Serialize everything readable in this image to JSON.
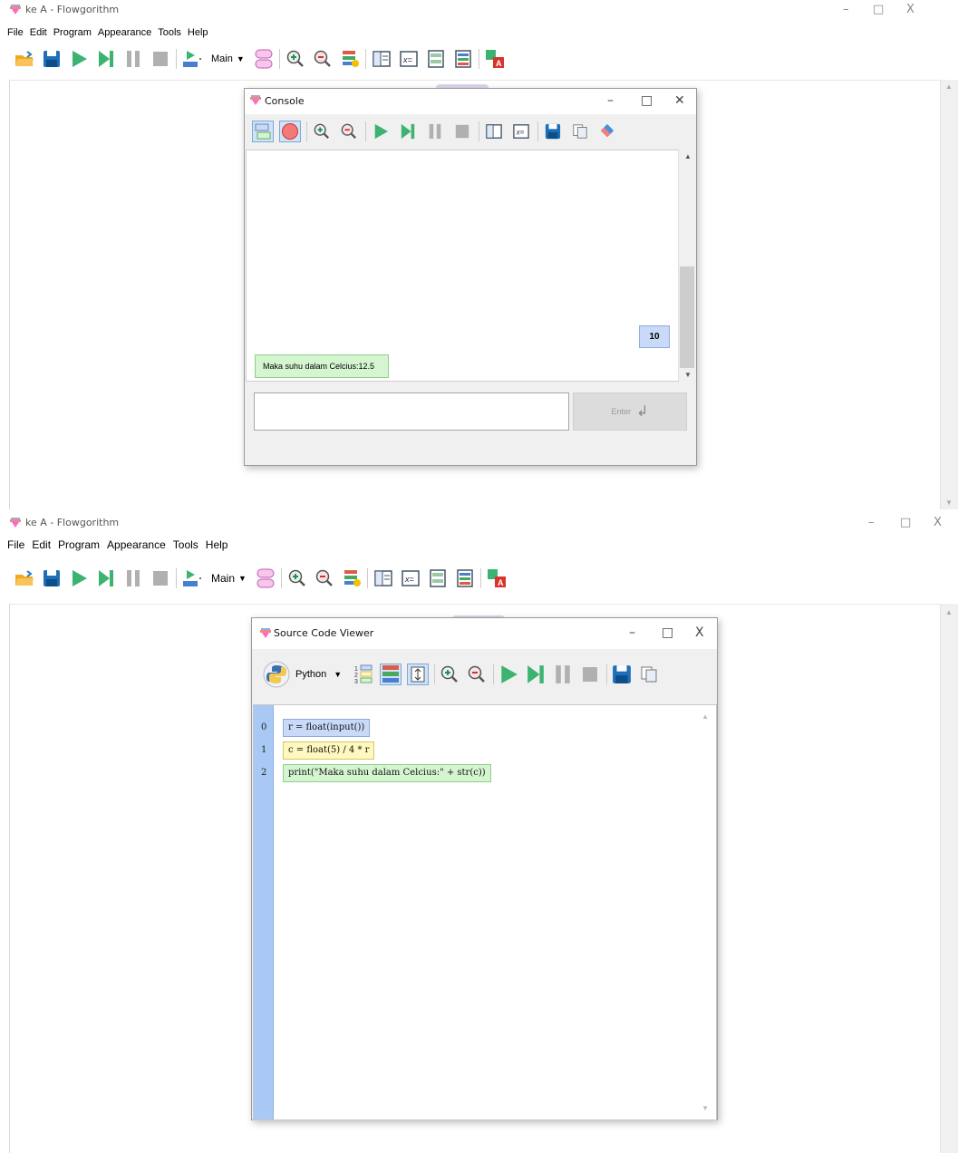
{
  "window1": {
    "title": "ke A - Flowgorithm",
    "controls": {
      "minimize": "–",
      "maximize": "□",
      "close": "X"
    },
    "menu": [
      "File",
      "Edit",
      "Program",
      "Appearance",
      "Tools",
      "Help"
    ],
    "function_selector": "Main",
    "console": {
      "title": "Console",
      "input_bubble": "10",
      "output_bubble": "Maka suhu dalam Celcius:12.5",
      "enter_label": "Enter"
    }
  },
  "window2": {
    "title": "ke A - Flowgorithm",
    "controls": {
      "minimize": "–",
      "maximize": "□",
      "close": "X"
    },
    "menu": [
      "File",
      "Edit",
      "Program",
      "Appearance",
      "Tools",
      "Help"
    ],
    "function_selector": "Main",
    "source_viewer": {
      "title": "Source Code Viewer",
      "language": "Python",
      "lines": [
        {
          "num": "0",
          "code": "r = float(input())"
        },
        {
          "num": "1",
          "code": "c = float(5) / 4 * r"
        },
        {
          "num": "2",
          "code": "print(\"Maka suhu dalam Celcius:\" + str(c))"
        }
      ]
    }
  },
  "colors": {
    "run": "#3cb371",
    "save": "#1e6fb8",
    "open": "#f2a81d",
    "zoom": "#2e8b57",
    "stop": "#b0b0b0"
  }
}
